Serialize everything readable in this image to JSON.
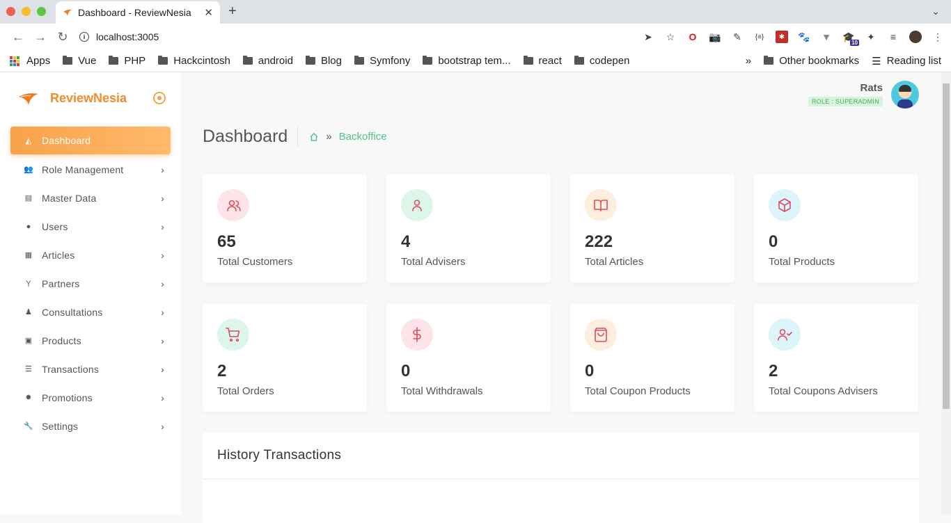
{
  "browser": {
    "tab_title": "Dashboard - ReviewNesia",
    "url": "localhost:3005",
    "bookmarks": [
      "Apps",
      "Vue",
      "PHP",
      "Hackcintosh",
      "android",
      "Blog",
      "Symfony",
      "bootstrap tem...",
      "react",
      "codepen"
    ],
    "other_bookmarks": "Other bookmarks",
    "reading_list": "Reading list",
    "ext_badge": "10"
  },
  "brand": {
    "name": "ReviewNesia"
  },
  "sidebar": {
    "items": [
      {
        "label": "Dashboard",
        "icon": "chart-area-icon",
        "active": true
      },
      {
        "label": "Role Management",
        "icon": "users-icon"
      },
      {
        "label": "Master Data",
        "icon": "table-icon"
      },
      {
        "label": "Users",
        "icon": "user-icon"
      },
      {
        "label": "Articles",
        "icon": "newspaper-icon"
      },
      {
        "label": "Partners",
        "icon": "child-icon"
      },
      {
        "label": "Consultations",
        "icon": "user-doctor-icon"
      },
      {
        "label": "Products",
        "icon": "gift-icon"
      },
      {
        "label": "Transactions",
        "icon": "list-icon"
      },
      {
        "label": "Promotions",
        "icon": "certificate-icon"
      },
      {
        "label": "Settings",
        "icon": "wrench-icon"
      }
    ]
  },
  "user": {
    "name": "Rats",
    "role": "ROLE : SUPERADMIN"
  },
  "page": {
    "title": "Dashboard",
    "crumb": "Backoffice",
    "crumb_sep": "»"
  },
  "cards": [
    {
      "value": "65",
      "label": "Total Customers",
      "icon": "users-icon",
      "bg": "#fde4e8",
      "fg": "#e04a5f"
    },
    {
      "value": "4",
      "label": "Total Advisers",
      "icon": "user-icon",
      "bg": "#dcf7ea",
      "fg": "#e04a5f"
    },
    {
      "value": "222",
      "label": "Total Articles",
      "icon": "book-open-icon",
      "bg": "#fdeedd",
      "fg": "#e04a5f"
    },
    {
      "value": "0",
      "label": "Total Products",
      "icon": "box-icon",
      "bg": "#dcf4fa",
      "fg": "#e04a5f"
    },
    {
      "value": "2",
      "label": "Total Orders",
      "icon": "cart-icon",
      "bg": "#dcf7ea",
      "fg": "#e04a5f"
    },
    {
      "value": "0",
      "label": "Total Withdrawals",
      "icon": "dollar-icon",
      "bg": "#fde4e8",
      "fg": "#e04a5f"
    },
    {
      "value": "0",
      "label": "Total Coupon Products",
      "icon": "shopping-bag-icon",
      "bg": "#fdeedd",
      "fg": "#e04a5f"
    },
    {
      "value": "2",
      "label": "Total Coupons Advisers",
      "icon": "user-check-icon",
      "bg": "#dcf4fa",
      "fg": "#e04a5f"
    }
  ],
  "history": {
    "title": "History Transactions"
  }
}
